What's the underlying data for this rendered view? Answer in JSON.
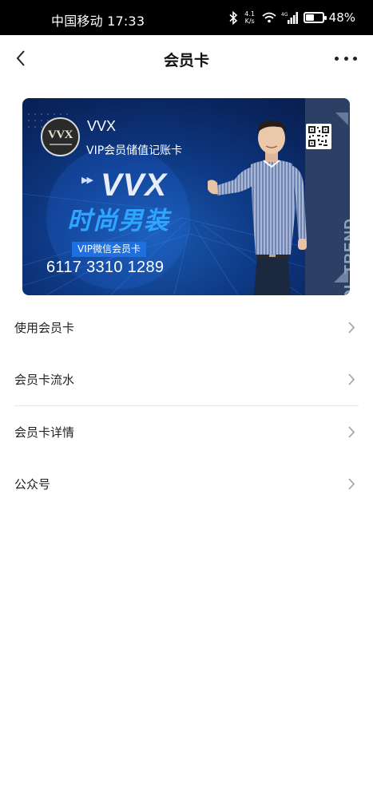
{
  "status_bar": {
    "carrier_time": "中国移动 17:33",
    "net_speed_value": "4.1",
    "net_speed_unit": "K/s",
    "battery_percent": "48%",
    "battery_level": 0.48,
    "icons": [
      "bluetooth-icon",
      "wifi-icon",
      "signal-4g-icon",
      "battery-icon"
    ]
  },
  "nav": {
    "title": "会员卡",
    "back_icon": "chevron-left-icon",
    "more_icon": "more-dots-icon"
  },
  "card": {
    "logo_text": "VVX",
    "brand_name": "VVX",
    "card_type": "VIP会员储值记账卡",
    "slogan_en": "VVX",
    "slogan_cn": "时尚男装",
    "side_text": "COOL TREND",
    "badge": "VIP微信会员卡",
    "card_number": "6117 3310 1289",
    "qr_icon": "qr-code-icon",
    "colors": {
      "card_base": "#0e3a86",
      "stripe": "#2c3f64",
      "slogan_cn": "#2ea6ff",
      "badge": "#1e6fe0"
    }
  },
  "menu": {
    "items": [
      {
        "label": "使用会员卡"
      },
      {
        "label": "会员卡流水"
      },
      {
        "label": "会员卡详情"
      },
      {
        "label": "公众号"
      }
    ]
  }
}
